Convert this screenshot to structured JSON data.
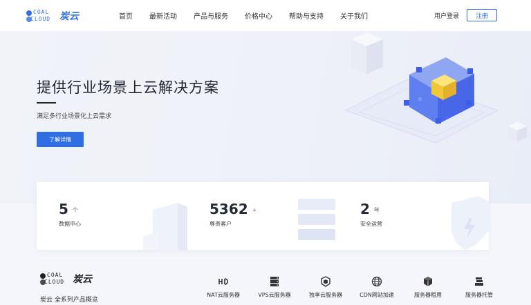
{
  "brand": {
    "mark_top": "COAL",
    "mark_bottom": "CLOUD",
    "name_cn": "炭云"
  },
  "nav": {
    "items": [
      "首页",
      "最新活动",
      "产品与服务",
      "价格中心",
      "帮助与支持",
      "关于我们"
    ],
    "login": "用户登录",
    "register": "注册"
  },
  "hero": {
    "title": "提供行业场景上云解决方案",
    "subtitle": "满足多行业场景化上云需求",
    "cta": "了解详情"
  },
  "stats": [
    {
      "value": "5",
      "unit": "个",
      "label": "数据中心"
    },
    {
      "value": "5362",
      "unit": "+",
      "label": "尊贵客户"
    },
    {
      "value": "2",
      "unit": "年",
      "label": "安全运营"
    }
  ],
  "footer": {
    "title": "炭云 全系列产品概览",
    "products": [
      {
        "label": "NAT云服务器",
        "icon": "nat-icon"
      },
      {
        "label": "VPS云服务器",
        "icon": "server-stack-icon"
      },
      {
        "label": "独享云服务器",
        "icon": "cube-icon"
      },
      {
        "label": "CDN网站加速",
        "icon": "globe-icon"
      },
      {
        "label": "服务器租用",
        "icon": "box-icon"
      },
      {
        "label": "服务器托管",
        "icon": "stack-icon"
      }
    ]
  },
  "colors": {
    "accent": "#2f6fe3",
    "cube": "#f2c83a"
  }
}
